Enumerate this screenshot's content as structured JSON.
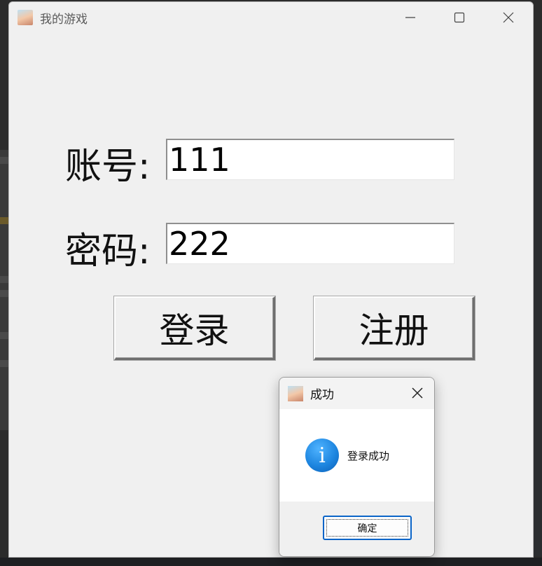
{
  "window": {
    "title": "我的游戏",
    "controls": [
      "minimize-icon",
      "maximize-icon",
      "close-icon"
    ]
  },
  "form": {
    "account_label": "账号:",
    "account_value": "111",
    "password_label": "密码:",
    "password_value": "222",
    "login_label": "登录",
    "register_label": "注册"
  },
  "dialog": {
    "title": "成功",
    "message": "登录成功",
    "ok_label": "确定",
    "icon": "info-icon",
    "info_glyph": "i"
  },
  "colors": {
    "window_bg": "#f0f0f0",
    "dialog_button_border": "#0a64c8",
    "info_icon": "#1e86e0"
  }
}
